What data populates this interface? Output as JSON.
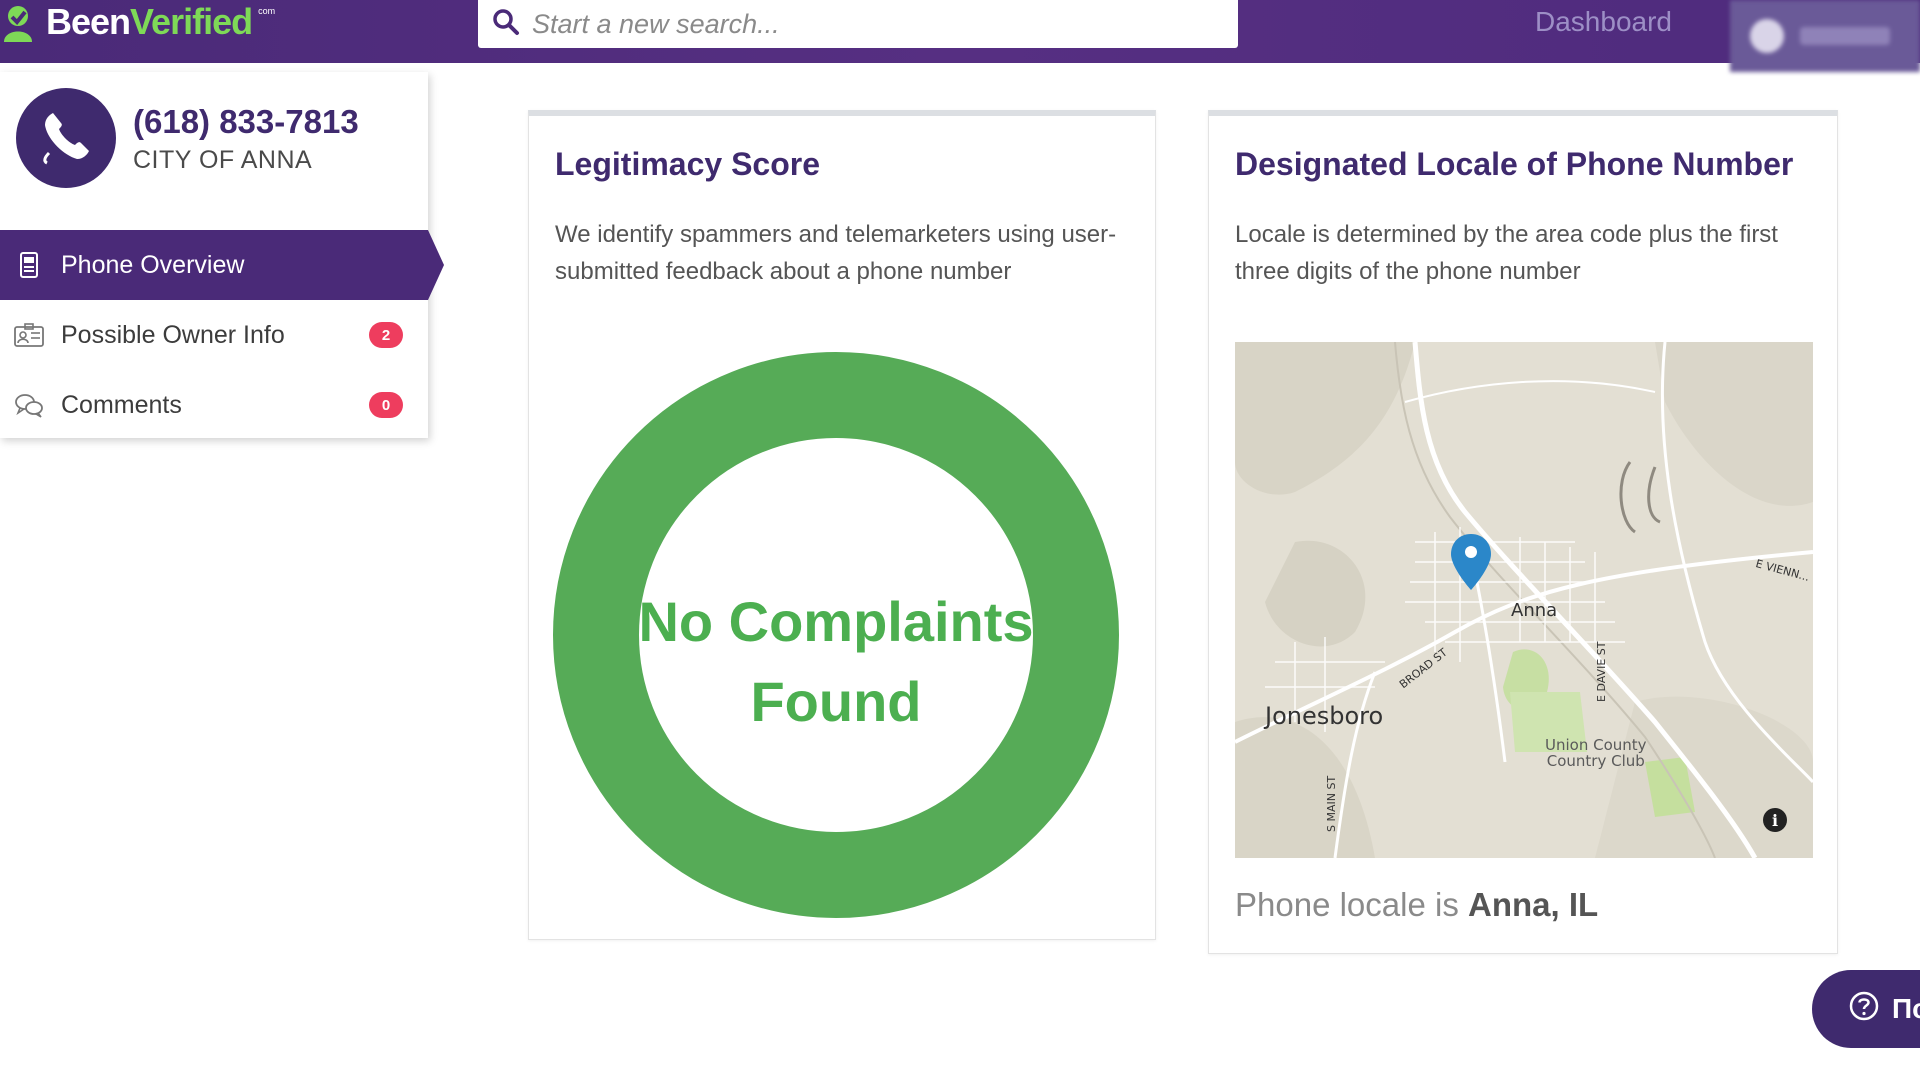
{
  "header": {
    "logo_text_primary": "Been",
    "logo_text_accent": "Verified",
    "logo_suffix": "com",
    "search_placeholder": "Start a new search...",
    "nav_dashboard": "Dashboard"
  },
  "sidebar": {
    "phone_number": "(618) 833-7813",
    "city": "CITY OF ANNA",
    "items": [
      {
        "label": "Phone Overview",
        "icon": "phone-document-icon",
        "active": true
      },
      {
        "label": "Possible Owner Info",
        "icon": "id-card-icon",
        "badge": "2"
      },
      {
        "label": "Comments",
        "icon": "chat-bubbles-icon",
        "badge": "0"
      }
    ]
  },
  "legitimacy": {
    "title": "Legitimacy Score",
    "description": "We identify spammers and telemarketers using user-submitted feedback about a phone number",
    "result_line1": "No Complaints",
    "result_line2": "Found",
    "color": "#56ab57"
  },
  "locale": {
    "title": "Designated Locale of Phone Number",
    "description": "Locale is determined by the area code plus the first three digits of the phone number",
    "map_labels": {
      "anna": "Anna",
      "jonesboro": "Jonesboro",
      "club_line1": "Union County",
      "club_line2": "Country Club",
      "broad_st": "BROAD ST",
      "davie_st": "E DAVIE ST",
      "main_st": "S MAIN ST",
      "vienna": "E VIENN..."
    },
    "locale_prefix": "Phone locale is ",
    "locale_value": "Anna, IL"
  },
  "help": {
    "label": "Пс"
  }
}
